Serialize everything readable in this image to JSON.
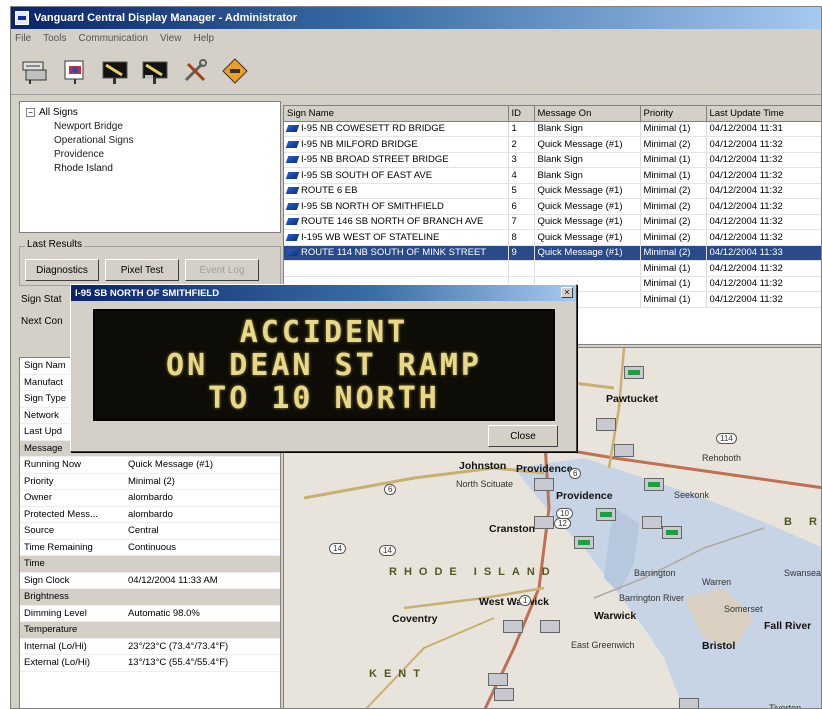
{
  "window": {
    "title": "Vanguard Central Display Manager - Administrator"
  },
  "menu": [
    "File",
    "Tools",
    "Communication",
    "View",
    "Help"
  ],
  "toolbar": {
    "icons": [
      "sign-list-icon",
      "camera-sign-icon",
      "sign-message-icon",
      "sign-edit-icon",
      "tools-icon",
      "road-sign-icon"
    ]
  },
  "tree": {
    "root": "All Signs",
    "children": [
      "Newport Bridge",
      "Operational Signs",
      "Providence",
      "Rhode Island"
    ]
  },
  "last_results": {
    "label": "Last Results",
    "buttons": [
      "Diagnostics",
      "Pixel Test",
      "Event Log"
    ]
  },
  "sign_info": {
    "status_label": "Sign Stat",
    "next_label": "Next Con"
  },
  "properties": [
    {
      "k": "Sign Nam",
      "v": ""
    },
    {
      "k": "Manufact",
      "v": ""
    },
    {
      "k": "Sign Type",
      "v": ""
    },
    {
      "k": "Network",
      "v": ""
    },
    {
      "k": "Last Upd",
      "v": ""
    },
    {
      "k": "Message",
      "v": "",
      "hdr": true
    },
    {
      "k": "Running Now",
      "v": "Quick Message (#1)"
    },
    {
      "k": "Priority",
      "v": "Minimal (2)"
    },
    {
      "k": "Owner",
      "v": "alombardo"
    },
    {
      "k": "Protected Mess...",
      "v": "alombardo"
    },
    {
      "k": "Source",
      "v": "Central"
    },
    {
      "k": "Time Remaining",
      "v": "Continuous"
    },
    {
      "k": "Time",
      "v": "",
      "hdr": true
    },
    {
      "k": "Sign Clock",
      "v": "04/12/2004 11:33 AM"
    },
    {
      "k": "Brightness",
      "v": "",
      "hdr": true
    },
    {
      "k": "Dimming Level",
      "v": "Automatic 98.0%"
    },
    {
      "k": "Temperature",
      "v": "",
      "hdr": true
    },
    {
      "k": "Internal (Lo/Hi)",
      "v": "23°/23°C (73.4°/73.4°F)"
    },
    {
      "k": "External (Lo/Hi)",
      "v": "13°/13°C (55.4°/55.4°F)"
    }
  ],
  "grid": {
    "columns": [
      "Sign Name",
      "ID",
      "Message On",
      "Priority",
      "Last Update Time"
    ],
    "rows": [
      [
        "I-95 NB COWESETT RD BRIDGE",
        "1",
        "Blank Sign",
        "Minimal (1)",
        "04/12/2004 11:31"
      ],
      [
        "I-95 NB MILFORD BRIDGE",
        "2",
        "Quick Message (#1)",
        "Minimal (2)",
        "04/12/2004 11:32"
      ],
      [
        "I-95 NB BROAD STREET BRIDGE",
        "3",
        "Blank Sign",
        "Minimal (1)",
        "04/12/2004 11:32"
      ],
      [
        "I-95 SB SOUTH OF EAST AVE",
        "4",
        "Blank Sign",
        "Minimal (1)",
        "04/12/2004 11:32"
      ],
      [
        "ROUTE 6 EB",
        "5",
        "Quick Message (#1)",
        "Minimal (2)",
        "04/12/2004 11:32"
      ],
      [
        "I-95 SB NORTH OF SMITHFIELD",
        "6",
        "Quick Message (#1)",
        "Minimal (2)",
        "04/12/2004 11:32"
      ],
      [
        "ROUTE 146 SB NORTH OF BRANCH AVE",
        "7",
        "Quick Message (#1)",
        "Minimal (2)",
        "04/12/2004 11:32"
      ],
      [
        "I-195 WB WEST OF STATELINE",
        "8",
        "Quick Message (#1)",
        "Minimal (2)",
        "04/12/2004 11:32"
      ],
      [
        "ROUTE 114 NB SOUTH OF MINK STREET",
        "9",
        "Quick Message (#1)",
        "Minimal (2)",
        "04/12/2004 11:33"
      ],
      [
        "",
        "",
        "",
        "Minimal (1)",
        "04/12/2004 11:32"
      ],
      [
        "",
        "",
        "",
        "Minimal (1)",
        "04/12/2004 11:32"
      ],
      [
        "",
        "",
        "",
        "Minimal (1)",
        "04/12/2004 11:32"
      ]
    ],
    "selected_row": 8
  },
  "popup": {
    "title": "I-95 SB NORTH OF SMITHFIELD",
    "lines": [
      "ACCIDENT",
      "ON DEAN ST RAMP",
      "TO 10 NORTH"
    ],
    "close_label": "Close"
  },
  "map": {
    "labels": [
      "Pawtucket",
      "Providence",
      "Providence",
      "Rehoboth",
      "Johnston",
      "North Scituate",
      "Seekonk",
      "Cranston",
      "Barrington",
      "Warren",
      "Swansea",
      "West Warwick",
      "Warwick",
      "Coventry",
      "Bristol",
      "Fall River",
      "East Greenwich",
      "Somerset",
      "Tiverton",
      "Barrington River"
    ],
    "state_name": "RHODE ISLAND",
    "state_name_2": "B R",
    "county_name": "KENT",
    "route_shields": [
      "6",
      "14",
      "6",
      "114",
      "10",
      "1",
      "12",
      "118",
      "14"
    ]
  }
}
